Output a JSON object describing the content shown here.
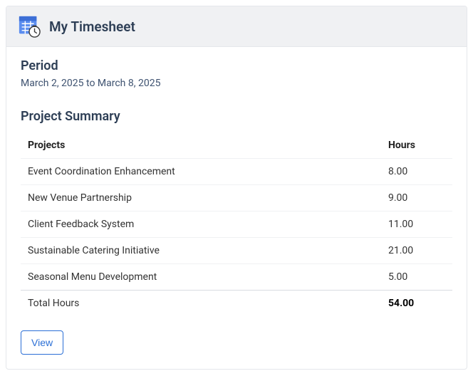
{
  "header": {
    "title": "My Timesheet"
  },
  "period": {
    "heading": "Period",
    "range": "March 2, 2025 to March 8, 2025"
  },
  "summary": {
    "heading": "Project Summary",
    "columns": {
      "projects": "Projects",
      "hours": "Hours"
    },
    "rows": [
      {
        "project": "Event Coordination Enhancement",
        "hours": "8.00"
      },
      {
        "project": "New Venue Partnership",
        "hours": "9.00"
      },
      {
        "project": "Client Feedback System",
        "hours": "11.00"
      },
      {
        "project": "Sustainable Catering Initiative",
        "hours": "21.00"
      },
      {
        "project": "Seasonal Menu Development",
        "hours": "5.00"
      }
    ],
    "total": {
      "label": "Total Hours",
      "hours": "54.00"
    }
  },
  "actions": {
    "view": "View"
  }
}
